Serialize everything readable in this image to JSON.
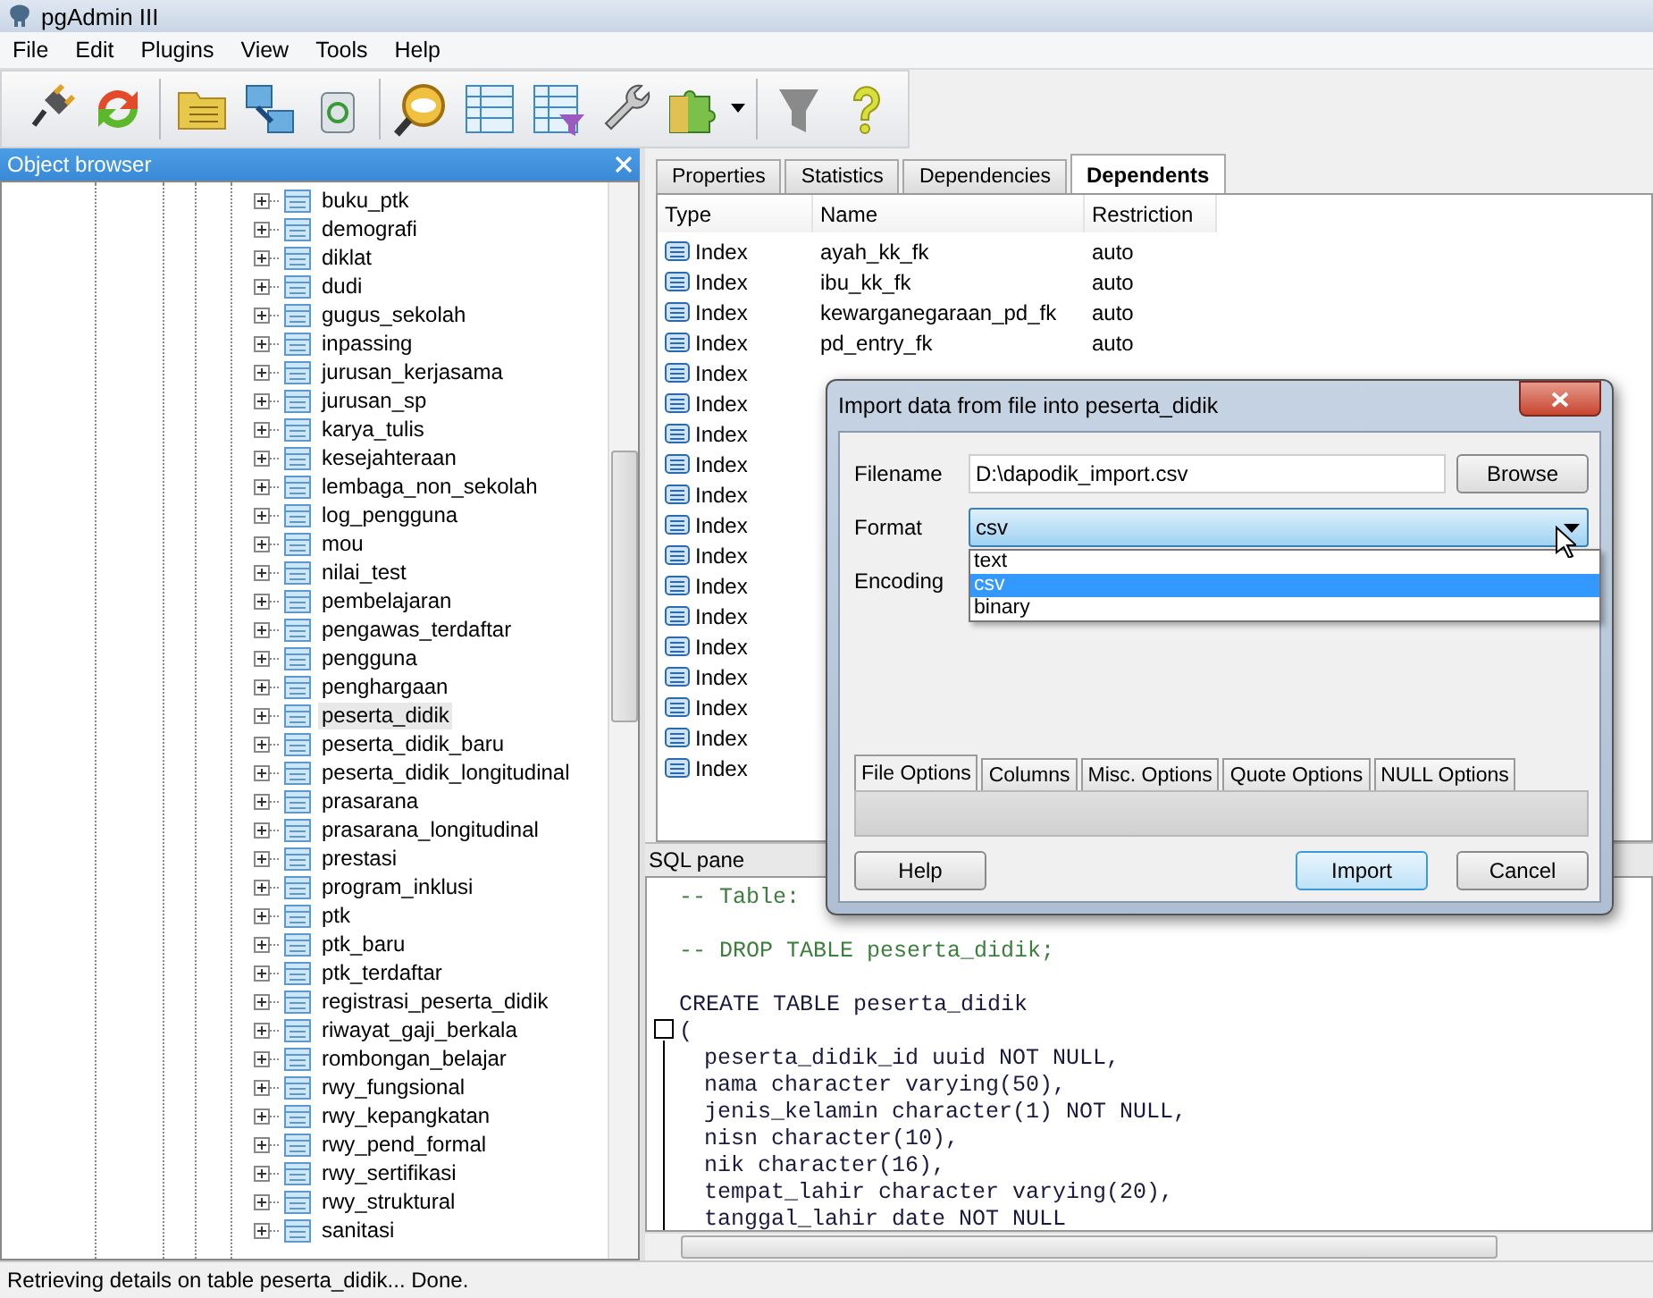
{
  "window": {
    "title": "pgAdmin III"
  },
  "menu": [
    "File",
    "Edit",
    "Plugins",
    "View",
    "Tools",
    "Help"
  ],
  "object_browser": {
    "title": "Object browser",
    "items": [
      {
        "label": "buku_ptk",
        "selected": false
      },
      {
        "label": "demografi",
        "selected": false
      },
      {
        "label": "diklat",
        "selected": false
      },
      {
        "label": "dudi",
        "selected": false
      },
      {
        "label": "gugus_sekolah",
        "selected": false
      },
      {
        "label": "inpassing",
        "selected": false
      },
      {
        "label": "jurusan_kerjasama",
        "selected": false
      },
      {
        "label": "jurusan_sp",
        "selected": false
      },
      {
        "label": "karya_tulis",
        "selected": false
      },
      {
        "label": "kesejahteraan",
        "selected": false
      },
      {
        "label": "lembaga_non_sekolah",
        "selected": false
      },
      {
        "label": "log_pengguna",
        "selected": false
      },
      {
        "label": "mou",
        "selected": false
      },
      {
        "label": "nilai_test",
        "selected": false
      },
      {
        "label": "pembelajaran",
        "selected": false
      },
      {
        "label": "pengawas_terdaftar",
        "selected": false
      },
      {
        "label": "pengguna",
        "selected": false
      },
      {
        "label": "penghargaan",
        "selected": false
      },
      {
        "label": "peserta_didik",
        "selected": true
      },
      {
        "label": "peserta_didik_baru",
        "selected": false
      },
      {
        "label": "peserta_didik_longitudinal",
        "selected": false
      },
      {
        "label": "prasarana",
        "selected": false
      },
      {
        "label": "prasarana_longitudinal",
        "selected": false
      },
      {
        "label": "prestasi",
        "selected": false
      },
      {
        "label": "program_inklusi",
        "selected": false
      },
      {
        "label": "ptk",
        "selected": false
      },
      {
        "label": "ptk_baru",
        "selected": false
      },
      {
        "label": "ptk_terdaftar",
        "selected": false
      },
      {
        "label": "registrasi_peserta_didik",
        "selected": false
      },
      {
        "label": "riwayat_gaji_berkala",
        "selected": false
      },
      {
        "label": "rombongan_belajar",
        "selected": false
      },
      {
        "label": "rwy_fungsional",
        "selected": false
      },
      {
        "label": "rwy_kepangkatan",
        "selected": false
      },
      {
        "label": "rwy_pend_formal",
        "selected": false
      },
      {
        "label": "rwy_sertifikasi",
        "selected": false
      },
      {
        "label": "rwy_struktural",
        "selected": false
      },
      {
        "label": "sanitasi",
        "selected": false
      }
    ]
  },
  "property_tabs": [
    {
      "label": "Properties",
      "selected": false
    },
    {
      "label": "Statistics",
      "selected": false
    },
    {
      "label": "Dependencies",
      "selected": false
    },
    {
      "label": "Dependents",
      "selected": true
    }
  ],
  "dependents": {
    "columns": [
      "Type",
      "Name",
      "Restriction"
    ],
    "rows": [
      {
        "type": "Index",
        "name": "ayah_kk_fk",
        "restriction": "auto"
      },
      {
        "type": "Index",
        "name": "ibu_kk_fk",
        "restriction": "auto"
      },
      {
        "type": "Index",
        "name": "kewarganegaraan_pd_fk",
        "restriction": "auto"
      },
      {
        "type": "Index",
        "name": "pd_entry_fk",
        "restriction": "auto"
      },
      {
        "type": "Index"
      },
      {
        "type": "Index"
      },
      {
        "type": "Index"
      },
      {
        "type": "Index"
      },
      {
        "type": "Index"
      },
      {
        "type": "Index"
      },
      {
        "type": "Index"
      },
      {
        "type": "Index"
      },
      {
        "type": "Index"
      },
      {
        "type": "Index"
      },
      {
        "type": "Index"
      },
      {
        "type": "Index"
      },
      {
        "type": "Index"
      },
      {
        "type": "Index"
      }
    ]
  },
  "sql_pane": {
    "title": "SQL pane",
    "lines": [
      {
        "kind": "comment",
        "text": "-- Table:"
      },
      {
        "kind": "blank"
      },
      {
        "kind": "comment",
        "text": "-- DROP TABLE peserta_didik;"
      },
      {
        "kind": "blank"
      },
      {
        "kind": "code",
        "text": "CREATE TABLE peserta_didik"
      },
      {
        "kind": "fold",
        "text": "("
      },
      {
        "kind": "body",
        "text": "peserta_didik_id uuid NOT NULL,"
      },
      {
        "kind": "body",
        "text": "nama character varying(50),"
      },
      {
        "kind": "body",
        "text": "jenis_kelamin character(1) NOT NULL,"
      },
      {
        "kind": "body",
        "text": "nisn character(10),"
      },
      {
        "kind": "body",
        "text": "nik character(16),"
      },
      {
        "kind": "body",
        "text": "tempat_lahir character varying(20),"
      },
      {
        "kind": "body",
        "text": "tanggal_lahir date NOT NULL"
      }
    ]
  },
  "dialog": {
    "title": "Import data from file into peserta_didik",
    "filename": {
      "label": "Filename",
      "value": "D:\\dapodik_import.csv"
    },
    "browse": "Browse",
    "format": {
      "label": "Format",
      "value": "csv",
      "options": [
        {
          "label": "text",
          "selected": false
        },
        {
          "label": "csv",
          "selected": true
        },
        {
          "label": "binary",
          "selected": false
        }
      ]
    },
    "encoding": {
      "label": "Encoding"
    },
    "tabs": [
      {
        "label": "File Options",
        "selected": true
      },
      {
        "label": "Columns",
        "selected": false
      },
      {
        "label": "Misc. Options",
        "selected": false
      },
      {
        "label": "Quote Options",
        "selected": false
      },
      {
        "label": "NULL Options",
        "selected": false
      }
    ],
    "buttons": [
      {
        "label": "Help",
        "kind": "normal"
      },
      {
        "label": "Import",
        "kind": "default"
      },
      {
        "label": "Cancel",
        "kind": "normal"
      }
    ]
  },
  "status_bar": "Retrieving details on table peserta_didik... Done."
}
